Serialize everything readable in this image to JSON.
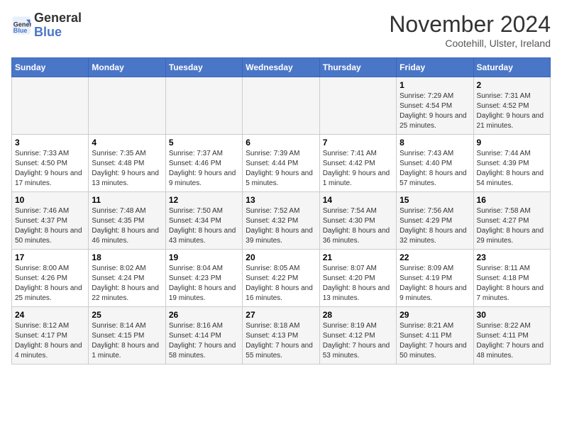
{
  "header": {
    "logo_line1": "General",
    "logo_line2": "Blue",
    "month_year": "November 2024",
    "location": "Cootehill, Ulster, Ireland"
  },
  "weekdays": [
    "Sunday",
    "Monday",
    "Tuesday",
    "Wednesday",
    "Thursday",
    "Friday",
    "Saturday"
  ],
  "weeks": [
    [
      {
        "day": "",
        "info": ""
      },
      {
        "day": "",
        "info": ""
      },
      {
        "day": "",
        "info": ""
      },
      {
        "day": "",
        "info": ""
      },
      {
        "day": "",
        "info": ""
      },
      {
        "day": "1",
        "info": "Sunrise: 7:29 AM\nSunset: 4:54 PM\nDaylight: 9 hours and 25 minutes."
      },
      {
        "day": "2",
        "info": "Sunrise: 7:31 AM\nSunset: 4:52 PM\nDaylight: 9 hours and 21 minutes."
      }
    ],
    [
      {
        "day": "3",
        "info": "Sunrise: 7:33 AM\nSunset: 4:50 PM\nDaylight: 9 hours and 17 minutes."
      },
      {
        "day": "4",
        "info": "Sunrise: 7:35 AM\nSunset: 4:48 PM\nDaylight: 9 hours and 13 minutes."
      },
      {
        "day": "5",
        "info": "Sunrise: 7:37 AM\nSunset: 4:46 PM\nDaylight: 9 hours and 9 minutes."
      },
      {
        "day": "6",
        "info": "Sunrise: 7:39 AM\nSunset: 4:44 PM\nDaylight: 9 hours and 5 minutes."
      },
      {
        "day": "7",
        "info": "Sunrise: 7:41 AM\nSunset: 4:42 PM\nDaylight: 9 hours and 1 minute."
      },
      {
        "day": "8",
        "info": "Sunrise: 7:43 AM\nSunset: 4:40 PM\nDaylight: 8 hours and 57 minutes."
      },
      {
        "day": "9",
        "info": "Sunrise: 7:44 AM\nSunset: 4:39 PM\nDaylight: 8 hours and 54 minutes."
      }
    ],
    [
      {
        "day": "10",
        "info": "Sunrise: 7:46 AM\nSunset: 4:37 PM\nDaylight: 8 hours and 50 minutes."
      },
      {
        "day": "11",
        "info": "Sunrise: 7:48 AM\nSunset: 4:35 PM\nDaylight: 8 hours and 46 minutes."
      },
      {
        "day": "12",
        "info": "Sunrise: 7:50 AM\nSunset: 4:34 PM\nDaylight: 8 hours and 43 minutes."
      },
      {
        "day": "13",
        "info": "Sunrise: 7:52 AM\nSunset: 4:32 PM\nDaylight: 8 hours and 39 minutes."
      },
      {
        "day": "14",
        "info": "Sunrise: 7:54 AM\nSunset: 4:30 PM\nDaylight: 8 hours and 36 minutes."
      },
      {
        "day": "15",
        "info": "Sunrise: 7:56 AM\nSunset: 4:29 PM\nDaylight: 8 hours and 32 minutes."
      },
      {
        "day": "16",
        "info": "Sunrise: 7:58 AM\nSunset: 4:27 PM\nDaylight: 8 hours and 29 minutes."
      }
    ],
    [
      {
        "day": "17",
        "info": "Sunrise: 8:00 AM\nSunset: 4:26 PM\nDaylight: 8 hours and 25 minutes."
      },
      {
        "day": "18",
        "info": "Sunrise: 8:02 AM\nSunset: 4:24 PM\nDaylight: 8 hours and 22 minutes."
      },
      {
        "day": "19",
        "info": "Sunrise: 8:04 AM\nSunset: 4:23 PM\nDaylight: 8 hours and 19 minutes."
      },
      {
        "day": "20",
        "info": "Sunrise: 8:05 AM\nSunset: 4:22 PM\nDaylight: 8 hours and 16 minutes."
      },
      {
        "day": "21",
        "info": "Sunrise: 8:07 AM\nSunset: 4:20 PM\nDaylight: 8 hours and 13 minutes."
      },
      {
        "day": "22",
        "info": "Sunrise: 8:09 AM\nSunset: 4:19 PM\nDaylight: 8 hours and 9 minutes."
      },
      {
        "day": "23",
        "info": "Sunrise: 8:11 AM\nSunset: 4:18 PM\nDaylight: 8 hours and 7 minutes."
      }
    ],
    [
      {
        "day": "24",
        "info": "Sunrise: 8:12 AM\nSunset: 4:17 PM\nDaylight: 8 hours and 4 minutes."
      },
      {
        "day": "25",
        "info": "Sunrise: 8:14 AM\nSunset: 4:15 PM\nDaylight: 8 hours and 1 minute."
      },
      {
        "day": "26",
        "info": "Sunrise: 8:16 AM\nSunset: 4:14 PM\nDaylight: 7 hours and 58 minutes."
      },
      {
        "day": "27",
        "info": "Sunrise: 8:18 AM\nSunset: 4:13 PM\nDaylight: 7 hours and 55 minutes."
      },
      {
        "day": "28",
        "info": "Sunrise: 8:19 AM\nSunset: 4:12 PM\nDaylight: 7 hours and 53 minutes."
      },
      {
        "day": "29",
        "info": "Sunrise: 8:21 AM\nSunset: 4:11 PM\nDaylight: 7 hours and 50 minutes."
      },
      {
        "day": "30",
        "info": "Sunrise: 8:22 AM\nSunset: 4:11 PM\nDaylight: 7 hours and 48 minutes."
      }
    ]
  ]
}
